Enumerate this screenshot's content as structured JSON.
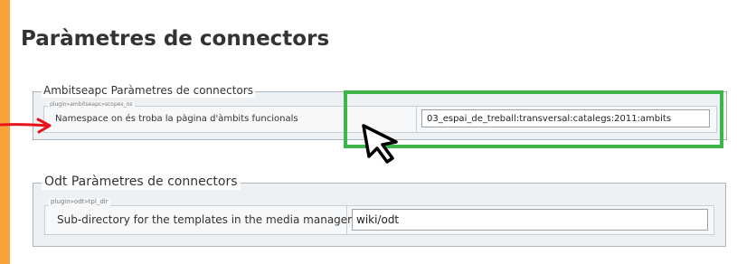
{
  "page": {
    "title": "Paràmetres de connectors",
    "accent_color": "#f7a33a",
    "annotation_color": "#3cb54a",
    "arrow_color": "#e8121b"
  },
  "sections": [
    {
      "legend": "Ambitseapc Paràmetres de connectors",
      "key": "plugin»ambitseapc»scopes_ns",
      "label": "Namespace on és troba la pàgina d'àmbits funcionals",
      "value": "03_espai_de_treball:transversal:catalegs:2011:ambits"
    },
    {
      "legend": "Odt Paràmetres de connectors",
      "key": "plugin»odt»tpl_dir",
      "label": "Sub-directory for the templates in the media manager",
      "value": "wiki/odt"
    }
  ],
  "icons": {
    "cursor": "mouse-pointer-icon",
    "arrow": "red-arrow-icon"
  }
}
